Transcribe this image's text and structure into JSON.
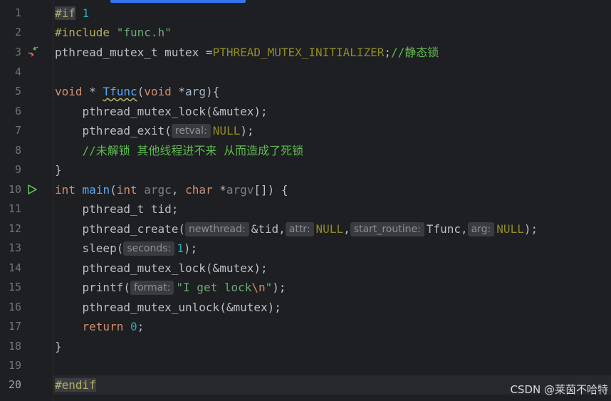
{
  "line_numbers": [
    "1",
    "2",
    "3",
    "4",
    "5",
    "6",
    "7",
    "8",
    "9",
    "10",
    "11",
    "12",
    "13",
    "14",
    "15",
    "16",
    "17",
    "18",
    "19",
    "20"
  ],
  "code": {
    "l1_kw": "#if",
    "l1_num": " 1",
    "l2_kw": "#include",
    "l2_str": " \"func.h\"",
    "l3_a": "pthread_mutex_t mutex =",
    "l3_macro": "PTHREAD_MUTEX_INITIALIZER",
    "l3_b": ";",
    "l3_cmt": "//静态锁",
    "l5_kw1": "void",
    "l5_a": " * ",
    "l5_fn": "Tfunc",
    "l5_b": "(",
    "l5_kw2": "void",
    "l5_c": " *",
    "l5_param": "arg",
    "l5_d": "){",
    "l6": "    pthread_mutex_lock(&mutex);",
    "l7_a": "    pthread_exit(",
    "l7_hint": "retval:",
    "l7_macro": "NULL",
    "l7_b": ");",
    "l8_cmt": "    //未解锁 其他线程进不来 从而造成了死锁",
    "l9": "}",
    "l10_kw1": "int",
    "l10_sp": " ",
    "l10_fn": "main",
    "l10_a": "(",
    "l10_kw2": "int",
    "l10_p1": " argc",
    "l10_b": ", ",
    "l10_kw3": "char",
    "l10_c": " *",
    "l10_p2": "argv",
    "l10_d": "[]) {",
    "l11": "    pthread_t tid;",
    "l12_a": "    pthread_create(",
    "l12_h1": "newthread:",
    "l12_b": "&tid,",
    "l12_h2": "attr:",
    "l12_m1": "NULL",
    "l12_c": ",",
    "l12_h3": "start_routine:",
    "l12_d": "Tfunc,",
    "l12_h4": "arg:",
    "l12_m2": "NULL",
    "l12_e": ");",
    "l13_a": "    sleep(",
    "l13_hint": "seconds:",
    "l13_num": "1",
    "l13_b": ");",
    "l14": "    pthread_mutex_lock(&mutex);",
    "l15_a": "    printf(",
    "l15_hint": "format:",
    "l15_str1": "\"I get lock",
    "l15_esc": "\\n",
    "l15_str2": "\"",
    "l15_b": ");",
    "l16": "    pthread_mutex_unlock(&mutex);",
    "l17_sp": "    ",
    "l17_kw": "return",
    "l17_num": " 0",
    "l17_b": ";",
    "l18": "}",
    "l20_kw": "#endif"
  },
  "gutter_icons": {
    "line3": "navigate-declaration-icon",
    "line10": "run-icon"
  },
  "watermark": "CSDN @莱茵不哈特",
  "colors": {
    "background": "#1e1f22",
    "keyword": "#cf8e6d",
    "string": "#6aab73",
    "number": "#2aacb8",
    "macro": "#908b25",
    "function": "#56a8f5",
    "comment": "#5fb950"
  }
}
